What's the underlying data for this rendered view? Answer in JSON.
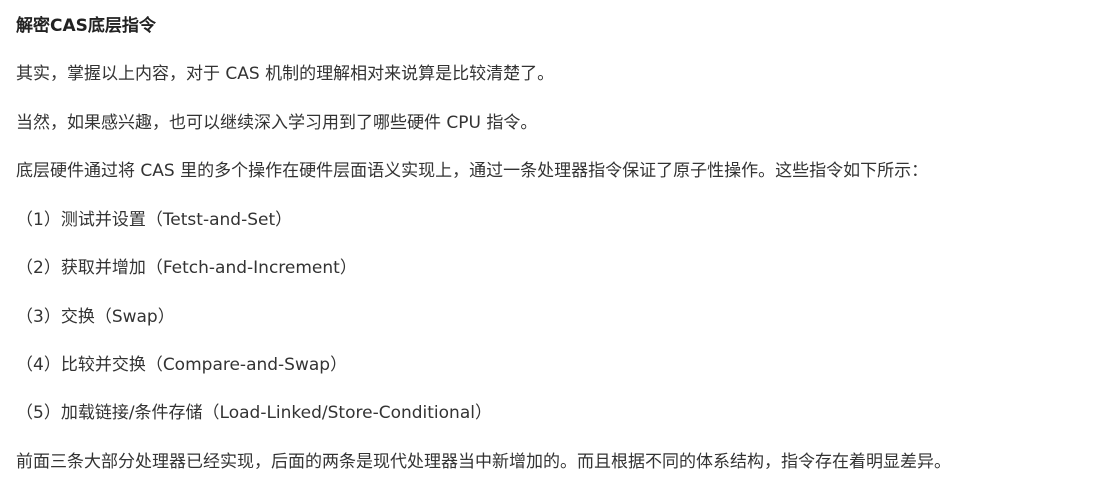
{
  "article": {
    "heading": "解密CAS底层指令",
    "paragraphs": [
      "其实，掌握以上内容，对于 CAS 机制的理解相对来说算是比较清楚了。",
      "当然，如果感兴趣，也可以继续深入学习用到了哪些硬件 CPU 指令。",
      "底层硬件通过将 CAS 里的多个操作在硬件层面语义实现上，通过一条处理器指令保证了原子性操作。这些指令如下所示："
    ],
    "instructions": [
      "（1）测试并设置（Tetst-and-Set）",
      "（2）获取并增加（Fetch-and-Increment）",
      "（3）交换（Swap）",
      "（4）比较并交换（Compare-and-Swap）",
      "（5）加载链接/条件存储（Load-Linked/Store-Conditional）"
    ],
    "closing": "前面三条大部分处理器已经实现，后面的两条是现代处理器当中新增加的。而且根据不同的体系结构，指令存在着明显差异。"
  },
  "colors": {
    "heading": "#222222",
    "text": "#333333",
    "background": "#ffffff"
  }
}
